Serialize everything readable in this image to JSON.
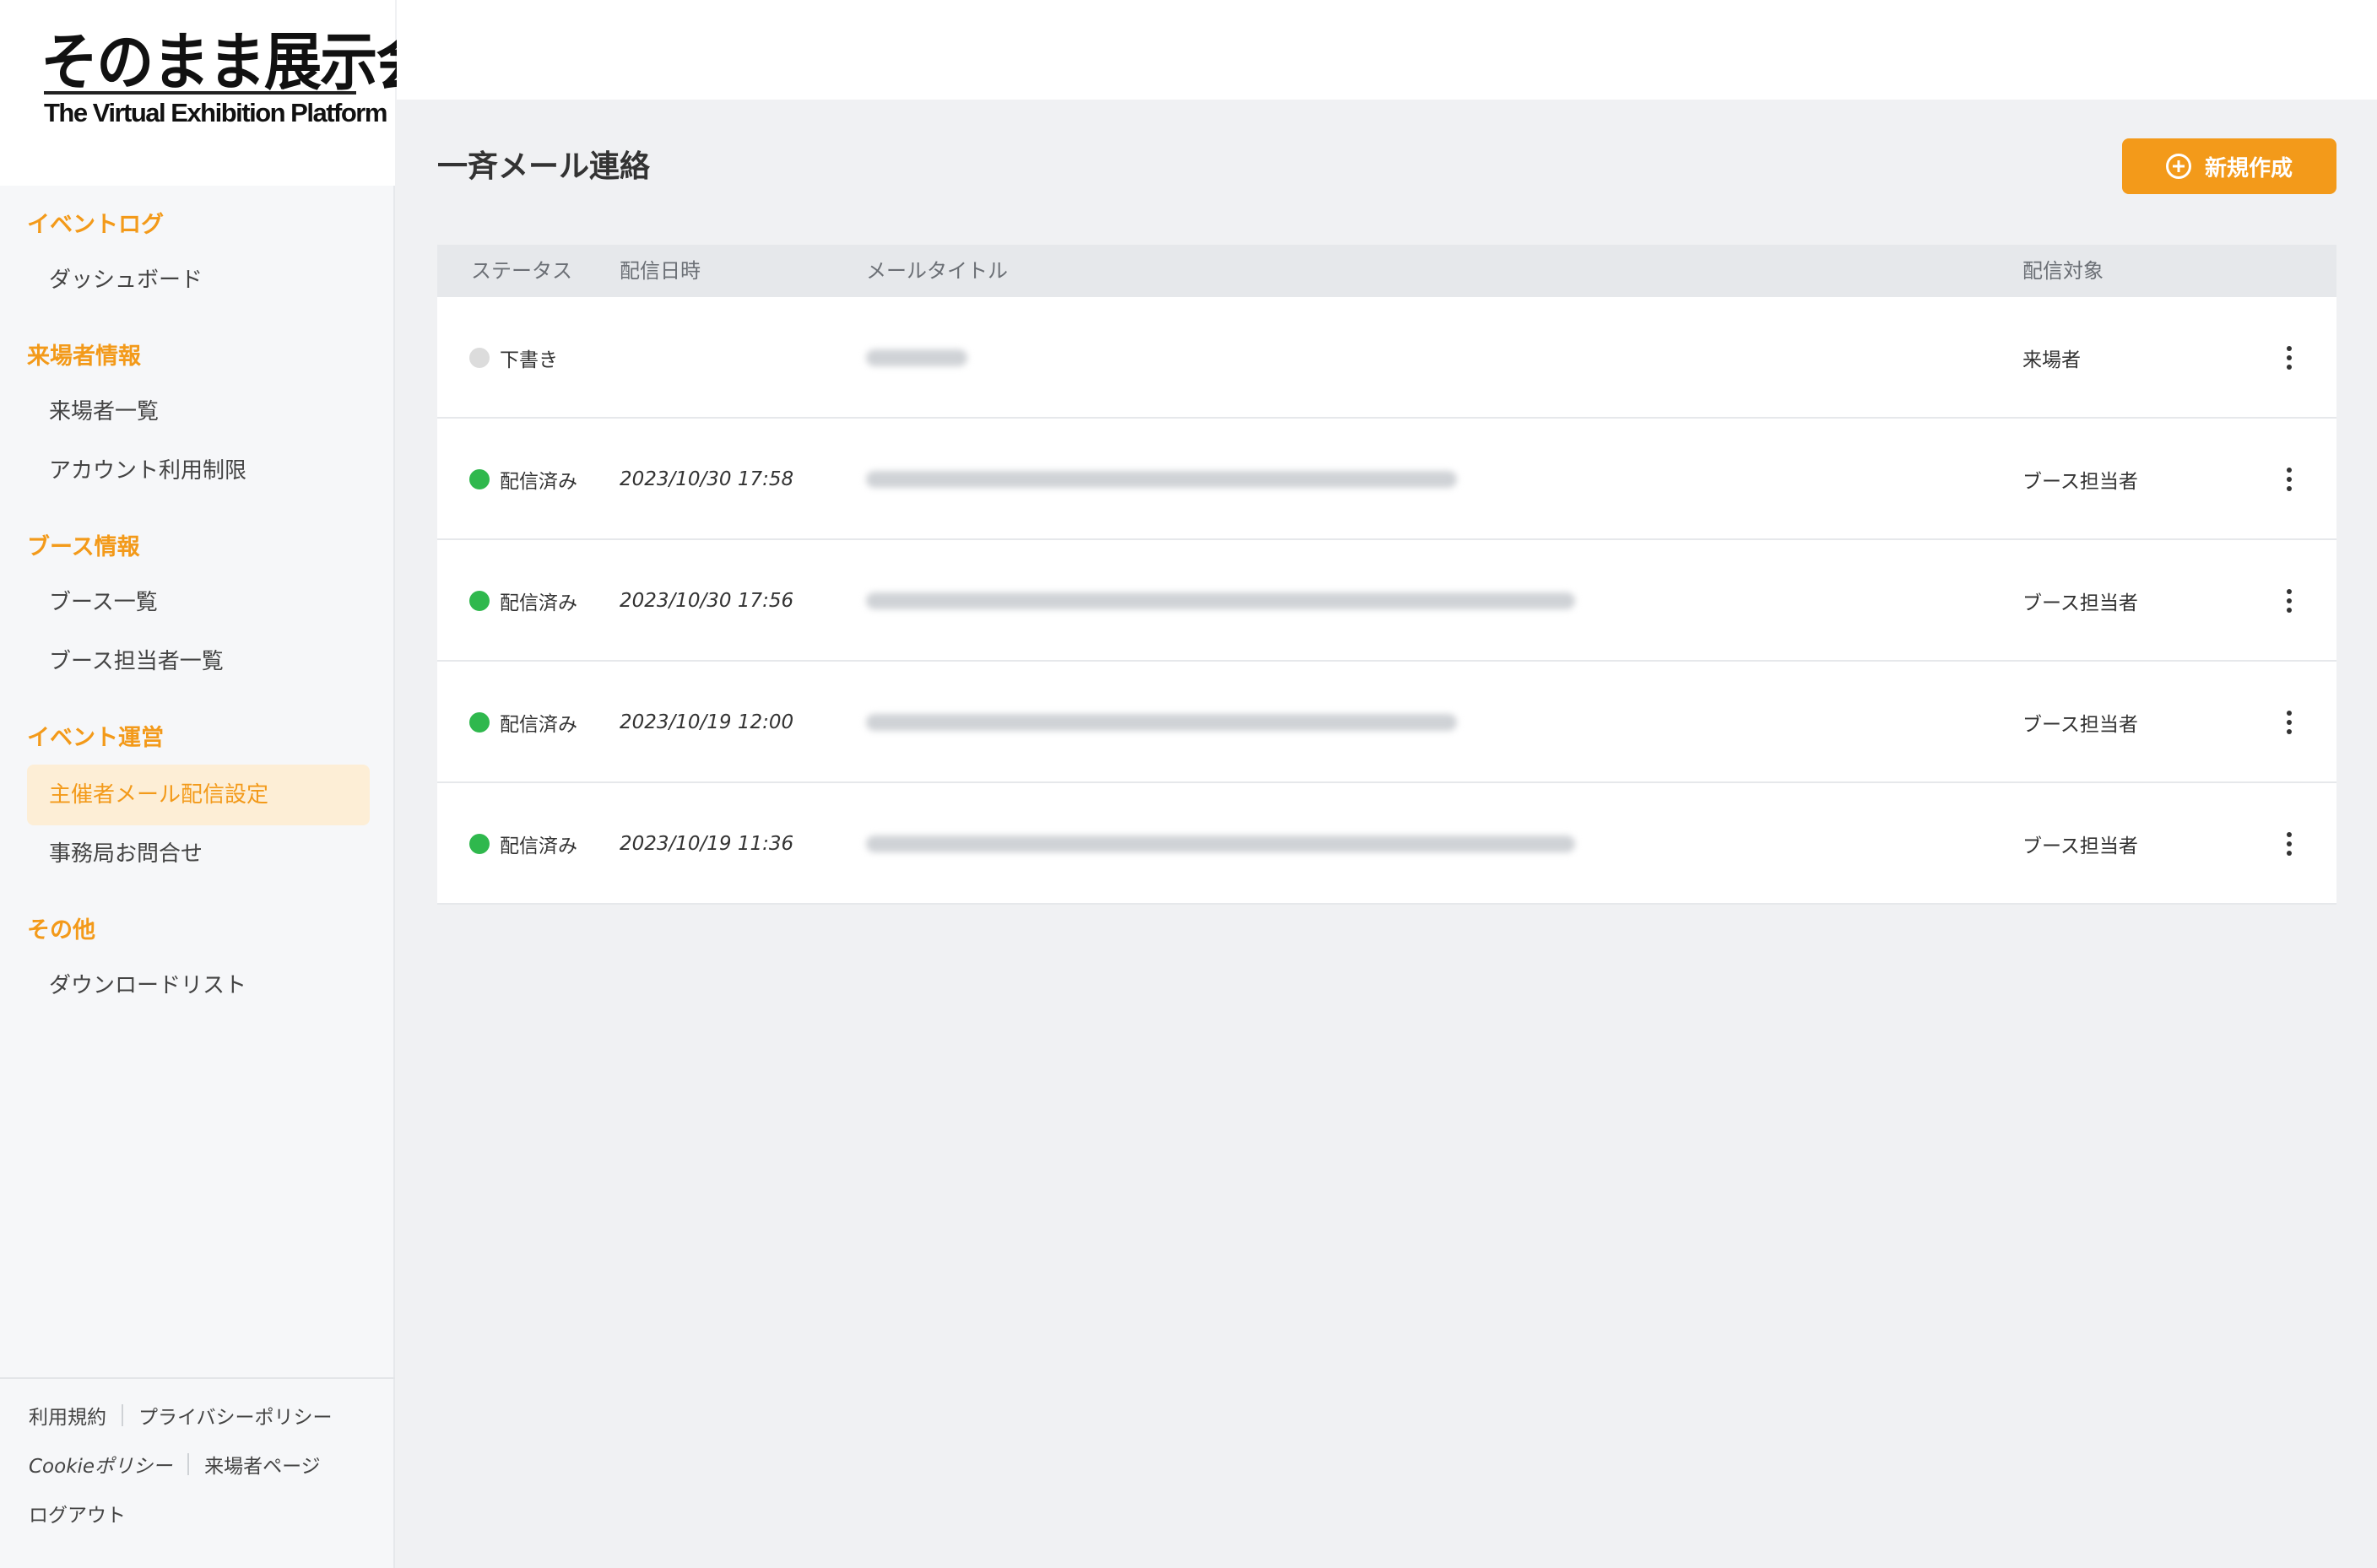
{
  "logo": {
    "title": "そのまま展示会",
    "subtitle": "The Virtual Exhibition Platform"
  },
  "sidebar": {
    "sections": [
      {
        "label": "イベントログ",
        "items": [
          {
            "label": "ダッシュボード"
          }
        ]
      },
      {
        "label": "来場者情報",
        "items": [
          {
            "label": "来場者一覧"
          },
          {
            "label": "アカウント利用制限"
          }
        ]
      },
      {
        "label": "ブース情報",
        "items": [
          {
            "label": "ブース一覧"
          },
          {
            "label": "ブース担当者一覧"
          }
        ]
      },
      {
        "label": "イベント運営",
        "items": [
          {
            "label": "主催者メール配信設定",
            "active": true
          },
          {
            "label": "事務局お問合せ"
          }
        ]
      },
      {
        "label": "その他",
        "items": [
          {
            "label": "ダウンロードリスト"
          }
        ]
      }
    ],
    "footer": {
      "terms": "利用規約",
      "privacy": "プライバシーポリシー",
      "cookie": "Cookieポリシー",
      "visitor_page": "来場者ページ",
      "logout": "ログアウト"
    }
  },
  "main": {
    "title": "一斉メール連絡",
    "new_button": "新規作成",
    "table": {
      "columns": {
        "status": "ステータス",
        "date": "配信日時",
        "mail_title": "メールタイトル",
        "target": "配信対象"
      },
      "rows": [
        {
          "status": "下書き",
          "status_color": "#dcdcdc",
          "date": "",
          "target": "来場者"
        },
        {
          "status": "配信済み",
          "status_color": "#2fb84d",
          "date": "2023/10/30 17:58",
          "target": "ブース担当者"
        },
        {
          "status": "配信済み",
          "status_color": "#2fb84d",
          "date": "2023/10/30 17:56",
          "target": "ブース担当者"
        },
        {
          "status": "配信済み",
          "status_color": "#2fb84d",
          "date": "2023/10/19 12:00",
          "target": "ブース担当者"
        },
        {
          "status": "配信済み",
          "status_color": "#2fb84d",
          "date": "2023/10/19 11:36",
          "target": "ブース担当者"
        }
      ]
    }
  },
  "colors": {
    "accent": "#f39a1a",
    "active_bg": "#fdeed6",
    "delivered": "#2fb84d",
    "draft": "#dcdcdc"
  }
}
